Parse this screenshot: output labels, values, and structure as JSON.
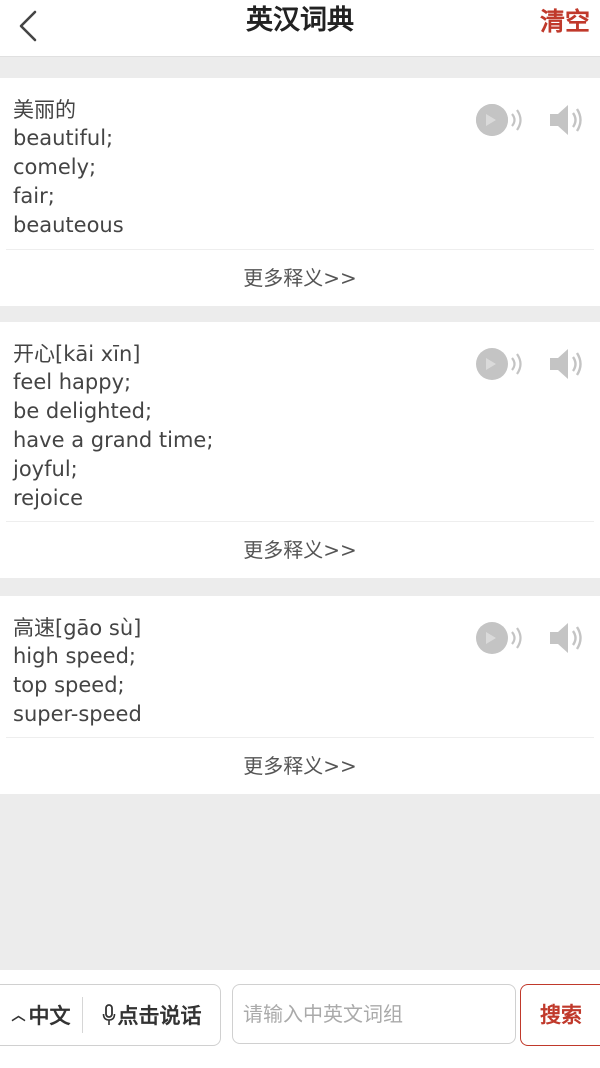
{
  "header": {
    "title": "英汉词典",
    "clear_label": "清空"
  },
  "colors": {
    "accent": "#c0392b"
  },
  "results": [
    {
      "word": "美丽的",
      "meanings": [
        "beautiful;",
        "comely;",
        "fair;",
        "beauteous"
      ],
      "more_label": "更多释义>>"
    },
    {
      "word": "开心[kāi xīn]",
      "meanings": [
        "feel happy;",
        "be delighted;",
        "have a grand time;",
        "joyful;",
        "rejoice"
      ],
      "more_label": "更多释义>>"
    },
    {
      "word": "高速[gāo sù]",
      "meanings": [
        "high speed;",
        "top speed;",
        "super-speed"
      ],
      "more_label": "更多释义>>"
    }
  ],
  "bottom": {
    "lang_label": "中文",
    "voice_label": "点击说话",
    "search_placeholder": "请输入中英文词组",
    "search_label": "搜索"
  }
}
